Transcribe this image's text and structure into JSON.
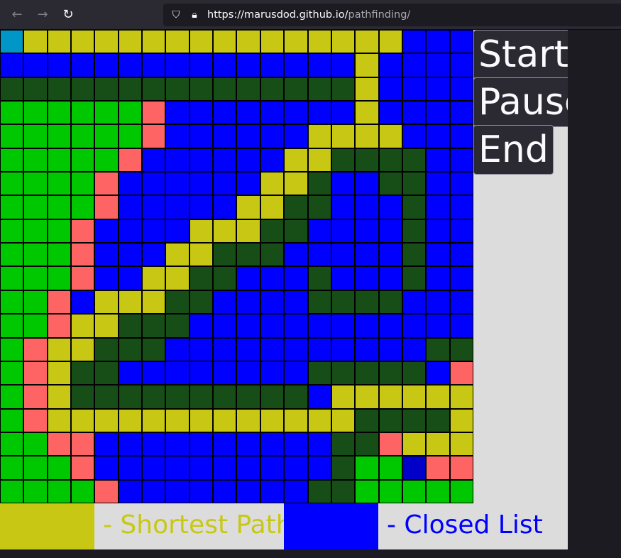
{
  "browser": {
    "url_host": "https://marusdod.github.io/",
    "url_path": "pathfinding/",
    "back_icon": "back-arrow-icon",
    "forward_icon": "forward-arrow-icon",
    "reload_icon": "reload-icon"
  },
  "buttons": {
    "start": "Start",
    "pause": "Pause",
    "end": "End"
  },
  "legend": {
    "shortest_path": "- Shortest Path",
    "closed_list": "- Closed List"
  },
  "colors": {
    "A": "#0000ff",
    "Y": "#c8c814",
    "D": "#174e17",
    "G": "#00c800",
    "R": "#ff6464",
    "S": "#0096c8",
    "E": "#0000c8",
    "shortest_path_text": "#c8c814",
    "closed_list_text": "#0000ff"
  },
  "grid": [
    "SYYYYYYYYYYYYYYYYAAA",
    "AAAAAAAAAAAAAAAYAAAA",
    "DDDDDDDDDDDDDDDYAAAA",
    "GGGGGGRAAAAAAAAYAAAA",
    "GGGGGGRAAAAAAYYYYAAA",
    "GGGGGRAAAAAAYYDDDDAA",
    "GGGGRAAAAAAYYDAADDAA",
    "GGGGRAAAAAYYDDAAADAA",
    "GGGRAAAAYYYDDAAAADAA",
    "GGGRAAAYYDDDAAAAADAA",
    "GGGRAAYYDDAAADAAADAA",
    "GGRAYYYDDAAAADDDDAAA",
    "GGRYYDDDAAAAAAAAAAAA",
    "GRYYDDDAAAAAAAAAAADD",
    "GRYDDAAAAAAAADDDDDAR",
    "GRYDDDDDDDDDDAYYYYYY",
    "GRYYYYYYYYYYYYYDDDDY",
    "GGRRAAAAAAAAAADDRYYY",
    "GGGRAAAAAAAAAADGGERR",
    "GGGGRAAAAAAAADDGGGGG"
  ]
}
